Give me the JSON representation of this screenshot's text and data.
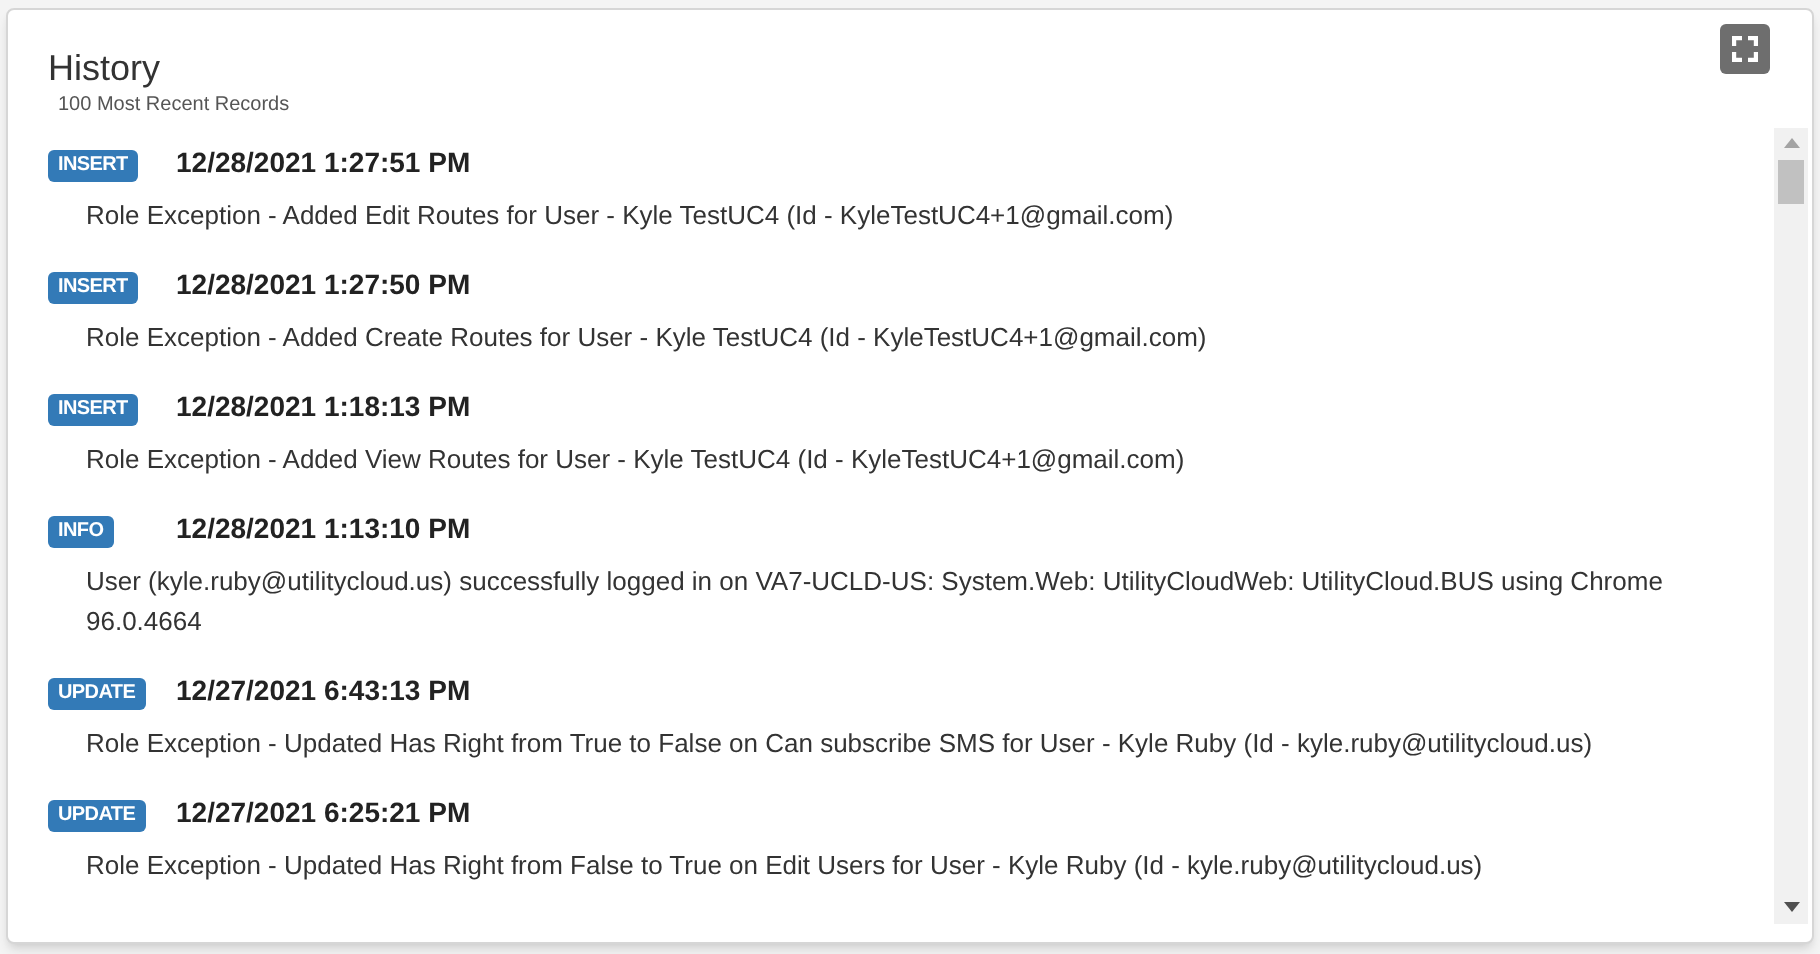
{
  "panel": {
    "title": "History",
    "subtitle": "100 Most Recent Records"
  },
  "records": [
    {
      "badge": "INSERT",
      "timestamp": "12/28/2021 1:27:51 PM",
      "message": "Role Exception - Added Edit Routes for User - Kyle TestUC4 (Id - KyleTestUC4+1@gmail.com)"
    },
    {
      "badge": "INSERT",
      "timestamp": "12/28/2021 1:27:50 PM",
      "message": "Role Exception - Added Create Routes for User - Kyle TestUC4 (Id - KyleTestUC4+1@gmail.com)"
    },
    {
      "badge": "INSERT",
      "timestamp": "12/28/2021 1:18:13 PM",
      "message": "Role Exception - Added View Routes for User - Kyle TestUC4 (Id - KyleTestUC4+1@gmail.com)"
    },
    {
      "badge": "INFO",
      "timestamp": "12/28/2021 1:13:10 PM",
      "message": "User (kyle.ruby@utilitycloud.us) successfully logged in on VA7-UCLD-US: System.Web: UtilityCloudWeb: UtilityCloud.BUS using Chrome 96.0.4664"
    },
    {
      "badge": "UPDATE",
      "timestamp": "12/27/2021 6:43:13 PM",
      "message": "Role Exception - Updated Has Right from True to False on Can subscribe SMS for User - Kyle Ruby (Id - kyle.ruby@utilitycloud.us)"
    },
    {
      "badge": "UPDATE",
      "timestamp": "12/27/2021 6:25:21 PM",
      "message": "Role Exception - Updated Has Right from False to True on Edit Users for User - Kyle Ruby (Id - kyle.ruby@utilitycloud.us)"
    }
  ]
}
